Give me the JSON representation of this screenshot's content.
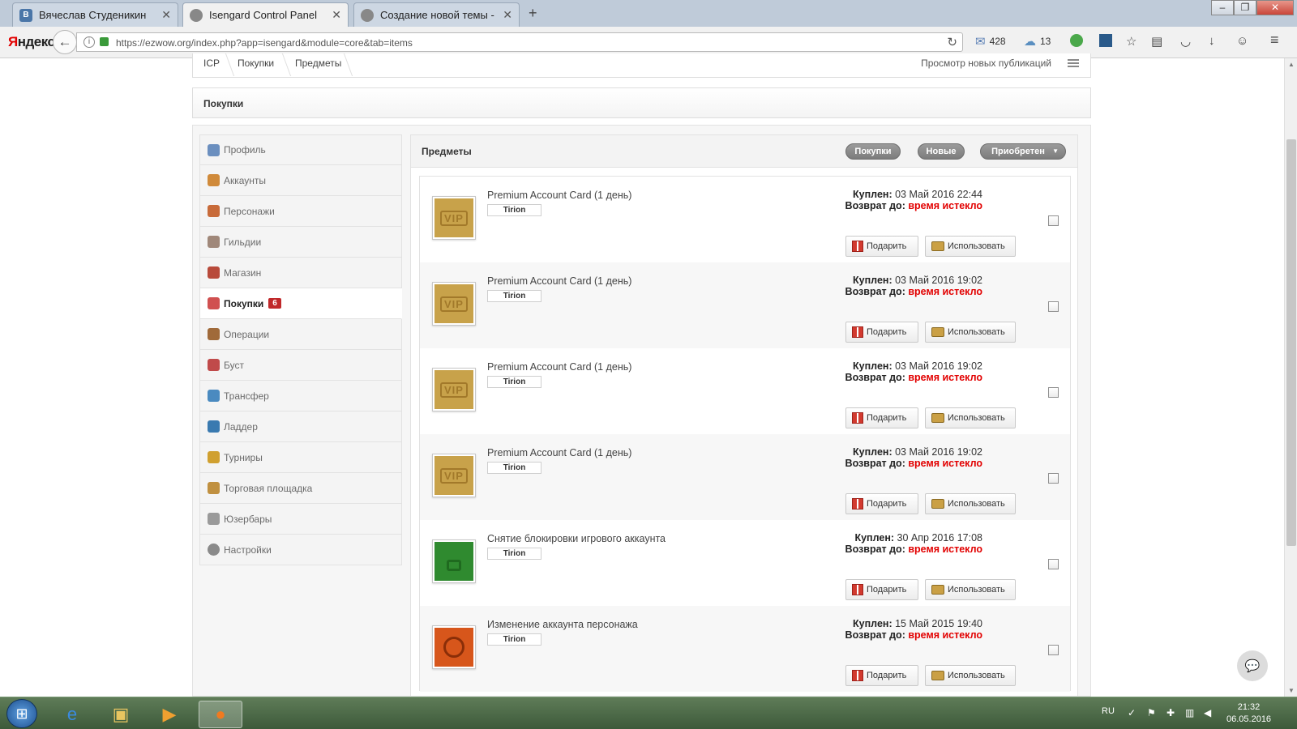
{
  "browser": {
    "tabs": [
      {
        "title": "Вячеслав Студеникин",
        "favicon": "vk-icon"
      },
      {
        "title": "Isengard Control Panel",
        "favicon": "globe-icon"
      },
      {
        "title": "Создание новой темы - Is...",
        "favicon": "globe-icon"
      }
    ],
    "new_tab": "+",
    "logo_ya": "Я",
    "logo_rest": "ндекс",
    "url": "https://ezwow.org/index.php?app=isengard&module=core&tab=items",
    "mail_count": "428",
    "weather_count": "13",
    "win_controls": [
      "–",
      "❐",
      "✕"
    ]
  },
  "breadcrumb": {
    "items": [
      "ICP",
      "Покупки",
      "Предметы"
    ],
    "new_publications": "Просмотр новых публикаций"
  },
  "section_title": "Покупки",
  "sidebar": {
    "items": [
      {
        "label": "Профиль",
        "icon": "profile-icon",
        "color": "#6b8fbf"
      },
      {
        "label": "Аккаунты",
        "icon": "accounts-icon",
        "color": "#d08a3a"
      },
      {
        "label": "Персонажи",
        "icon": "characters-icon",
        "color": "#c86b3a"
      },
      {
        "label": "Гильдии",
        "icon": "guilds-icon",
        "color": "#a0887a"
      },
      {
        "label": "Магазин",
        "icon": "shop-icon",
        "color": "#b84a3a"
      },
      {
        "label": "Покупки",
        "icon": "purchases-icon",
        "color": "#d05050",
        "badge": "6"
      },
      {
        "label": "Операции",
        "icon": "operations-icon",
        "color": "#a06a3a"
      },
      {
        "label": "Буст",
        "icon": "boost-icon",
        "color": "#c04a4a"
      },
      {
        "label": "Трансфер",
        "icon": "transfer-icon",
        "color": "#4a8ac0"
      },
      {
        "label": "Ладдер",
        "icon": "ladder-icon",
        "color": "#3a7ab0"
      },
      {
        "label": "Турниры",
        "icon": "tournaments-icon",
        "color": "#d0a030"
      },
      {
        "label": "Торговая площадка",
        "icon": "marketplace-icon",
        "color": "#c09040"
      },
      {
        "label": "Юзербары",
        "icon": "userbars-icon",
        "color": "#9a9a9a"
      },
      {
        "label": "Настройки",
        "icon": "settings-icon",
        "color": "#8a8a8a"
      }
    ]
  },
  "panel": {
    "title": "Предметы",
    "filters": [
      "Покупки",
      "Новые",
      "Приобретен"
    ]
  },
  "labels": {
    "bought": "Куплен:",
    "refund": "Возврат до:",
    "gift": "Подарить",
    "use": "Использовать"
  },
  "items": [
    {
      "name": "Premium Account Card (1 день)",
      "realm": "Tirion",
      "bought": "03 Май 2016 22:44",
      "refund": "время истекло",
      "thumb": "vip"
    },
    {
      "name": "Premium Account Card (1 день)",
      "realm": "Tirion",
      "bought": "03 Май 2016 19:02",
      "refund": "время истекло",
      "thumb": "vip"
    },
    {
      "name": "Premium Account Card (1 день)",
      "realm": "Tirion",
      "bought": "03 Май 2016 19:02",
      "refund": "время истекло",
      "thumb": "vip"
    },
    {
      "name": "Premium Account Card (1 день)",
      "realm": "Tirion",
      "bought": "03 Май 2016 19:02",
      "refund": "время истекло",
      "thumb": "vip"
    },
    {
      "name": "Снятие блокировки игрового аккаунта",
      "realm": "Tirion",
      "bought": "30 Апр 2016 17:08",
      "refund": "время истекло",
      "thumb": "unlock"
    },
    {
      "name": "Изменение аккаунта персонажа",
      "realm": "Tirion",
      "bought": "15 Май 2015 19:40",
      "refund": "время истекло",
      "thumb": "change"
    }
  ],
  "taskbar": {
    "lang": "RU",
    "time": "21:32",
    "date": "06.05.2016"
  }
}
